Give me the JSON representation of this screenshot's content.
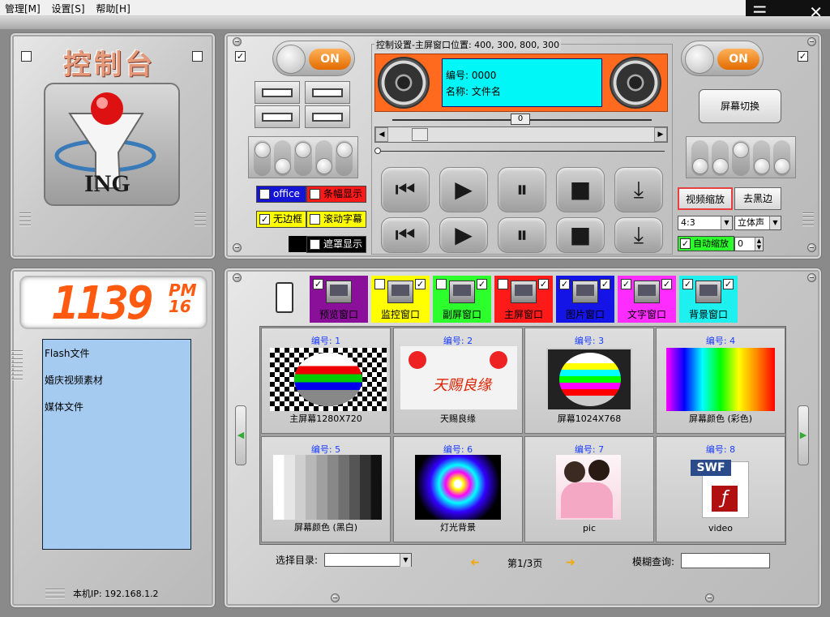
{
  "menu": {
    "items": [
      "管理[M]",
      "设置[S]",
      "帮助[H]"
    ]
  },
  "window_controls": {
    "menu": "☰",
    "minimize": "_",
    "close": "✕"
  },
  "logo": {
    "title": "控制台",
    "brand": "ING"
  },
  "toggles": {
    "left": "ON",
    "right": "ON"
  },
  "tags": {
    "office": "office",
    "banner": "条幅显示",
    "no_border": "无边框",
    "scroll_text": "滚动字幕",
    "mask": "遮罩显示"
  },
  "control": {
    "caption": "控制设置-主屏窗口位置: 400, 300, 800, 300",
    "lcd_line1": "编号: 0000",
    "lcd_line2": "名称: 文件名",
    "position_value": "0"
  },
  "player_icons": {
    "prev": "⏮",
    "play": "▶",
    "pause": "⏸",
    "stop": "■",
    "download": "⤓"
  },
  "right": {
    "screen_switch": "屏幕切换",
    "video_zoom": "视频缩放",
    "remove_black": "去黑边",
    "aspect": "4:3",
    "audio": "立体声",
    "auto_zoom": "自动缩放",
    "auto_zoom_value": "0"
  },
  "clock": {
    "time": "1139",
    "ampm": "PM",
    "seconds": "16"
  },
  "files": [
    "Flash文件",
    "婚庆视频素材",
    "媒体文件"
  ],
  "ip_label": "本机IP: 192.168.1.2",
  "windows": [
    {
      "label": "预览窗口",
      "color": "#8a0f99"
    },
    {
      "label": "监控窗口",
      "color": "#ffff00"
    },
    {
      "label": "副屏窗口",
      "color": "#2cff2c"
    },
    {
      "label": "主屏窗口",
      "color": "#ff1a1a"
    },
    {
      "label": "图片窗口",
      "color": "#1414e6"
    },
    {
      "label": "文字窗口",
      "color": "#ff2cff"
    },
    {
      "label": "背景窗口",
      "color": "#1ef0f0"
    }
  ],
  "media": [
    {
      "num": "编号: 1",
      "caption": "主屏幕1280X720"
    },
    {
      "num": "编号: 2",
      "caption": "天赐良缘"
    },
    {
      "num": "编号: 3",
      "caption": "屏幕1024X768"
    },
    {
      "num": "编号: 4",
      "caption": "屏幕颜色 (彩色)"
    },
    {
      "num": "编号: 5",
      "caption": "屏幕颜色 (黑白)"
    },
    {
      "num": "编号: 6",
      "caption": "灯光背景"
    },
    {
      "num": "编号: 7",
      "caption": "pic"
    },
    {
      "num": "编号: 8",
      "caption": "video"
    }
  ],
  "media_extra": {
    "wedding_text": "天赐良缘",
    "swf_label": "SWF"
  },
  "footer": {
    "dir_label": "选择目录:",
    "page": "第1/3页",
    "search_label": "模糊查询:",
    "prev_arrow": "➜",
    "next_arrow": "➜"
  }
}
